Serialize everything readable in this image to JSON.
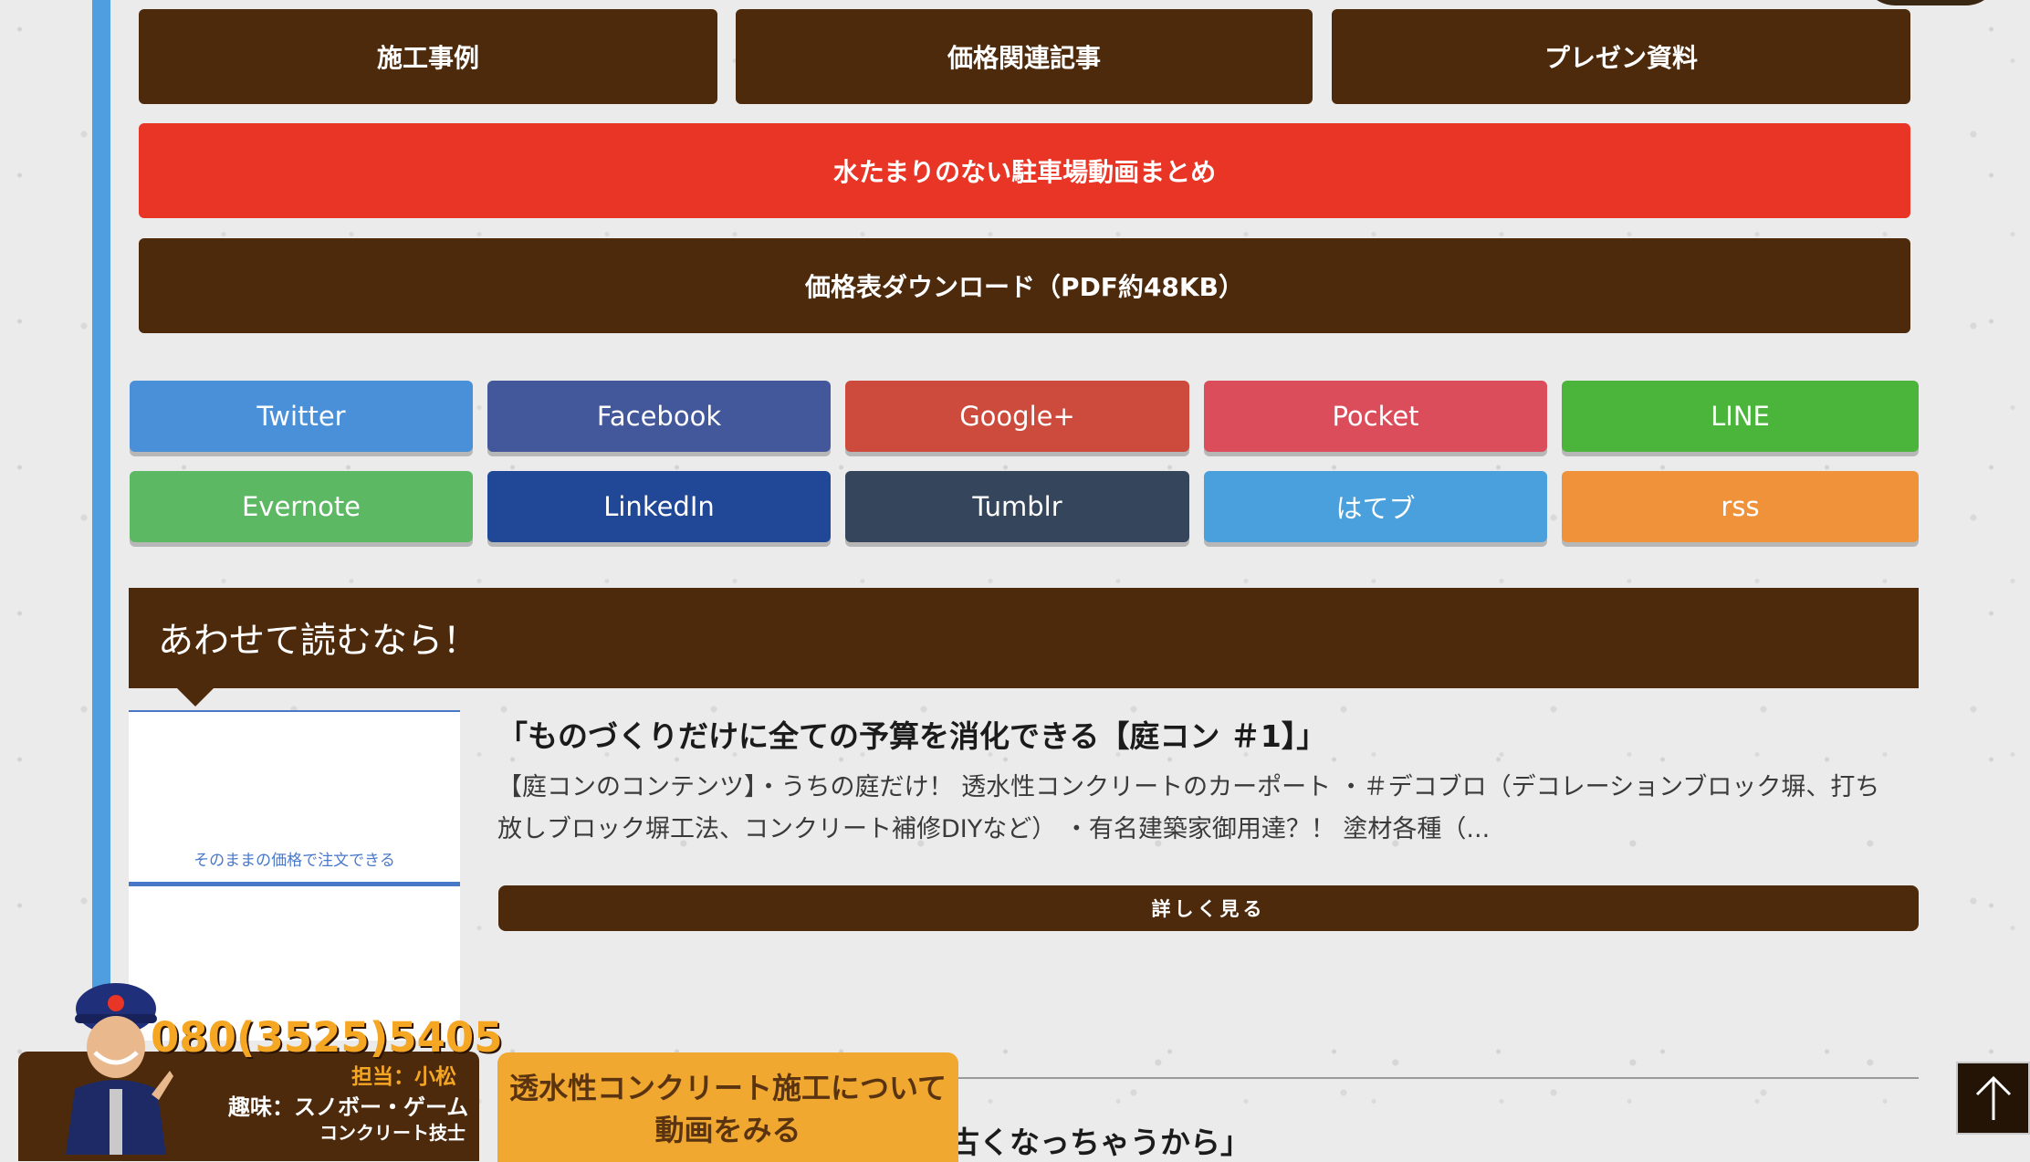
{
  "nav_buttons": {
    "case_studies": "施工事例",
    "price_articles": "価格関連記事",
    "presentation": "プレゼン資料",
    "parking_videos": "水たまりのない駐車場動画まとめ",
    "price_download": "価格表ダウンロード（PDF約48KB）"
  },
  "share": {
    "twitter": "Twitter",
    "facebook": "Facebook",
    "googleplus": "Google+",
    "pocket": "Pocket",
    "line": "LINE",
    "evernote": "Evernote",
    "linkedin": "LinkedIn",
    "tumblr": "Tumblr",
    "hatebu": "はてブ",
    "rss": "rss"
  },
  "related": {
    "heading": "あわせて読むなら！",
    "thumb_caption": "そのままの価格で注文できる",
    "post_title": "「ものづくりだけに全ての予算を消化できる【庭コン ＃1】」",
    "post_excerpt": "【庭コンのコンテンツ】・うちの庭だけ！ 透水性コンクリートのカーポート ・＃デコブロ（デコレーションブロック塀、打ち放しブロック塀工法、コンクリート補修DIYなど） ・有名建築家御用達？！ 塗材各種（...",
    "more_label": "詳しく見る",
    "next_title_partial": "古くなっちゃうから」"
  },
  "phone_banner": {
    "phone": "080(3525)5405",
    "staff": "担当：小松",
    "hobby": "趣味：スノボー・ゲーム",
    "skill": "コンクリート技士"
  },
  "video_banner": {
    "line1": "透水性コンクリート施工について",
    "line2": "動画をみる"
  },
  "colors": {
    "brown": "#4d2a0c",
    "red": "#e83526",
    "rail_blue": "#4f9ee0",
    "twitter": "#4a90d9",
    "facebook": "#43589a",
    "googleplus": "#cc4b3d",
    "pocket": "#dc4d5c",
    "line": "#4ab43b",
    "evernote": "#5cb863",
    "linkedin": "#214797",
    "tumblr": "#35465c",
    "hatebu": "#4aa0dc",
    "rss": "#f0923a",
    "video_orange": "#f0a830"
  }
}
